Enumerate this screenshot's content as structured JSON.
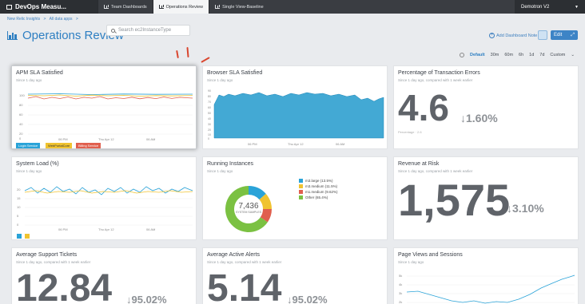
{
  "topbar": {
    "app_title": "DevOps Measu...",
    "tabs": [
      "Team Dashboards",
      "Operations Review",
      "Single View-Baseline"
    ],
    "account": "Demotron V2"
  },
  "breadcrumb": [
    "New Relic Insights",
    ">",
    "All data apps",
    ">"
  ],
  "page_title": "Operations Review",
  "search": {
    "placeholder": "Search ec2InstanceType"
  },
  "actions": {
    "note": "Add Dashboard Note",
    "edit": "Edit"
  },
  "time_range": {
    "options": [
      "Default",
      "30m",
      "60m",
      "6h",
      "1d",
      "7d",
      "Custom"
    ],
    "selected": "Default"
  },
  "widgets": {
    "apm": {
      "title": "APM SLA Satisfied",
      "subtitle": "Since 1 day ago",
      "y_ticks": [
        "100",
        "80",
        "60",
        "40",
        "20",
        "0"
      ],
      "x_ticks": [
        "06 PM",
        "Thu Apr 12",
        "06 AM"
      ],
      "legend": [
        "Login Service",
        "WebPortalCore",
        "Billing Service"
      ],
      "colors": [
        "#2aa3d8",
        "#f0c330",
        "#e05f4e"
      ]
    },
    "browser": {
      "title": "Browser SLA Satisfied",
      "subtitle": "Since 1 day ago",
      "y_ticks": [
        "90",
        "80",
        "70",
        "60",
        "50",
        "40",
        "30",
        "20",
        "10",
        "0"
      ],
      "x_ticks": [
        "06 PM",
        "Thu Apr 12",
        "06 AM"
      ],
      "color": "#43a9d4"
    },
    "errors": {
      "title": "Percentage of Transaction Errors",
      "subtitle": "Since 1 day ago, compared with 1 week earlier",
      "value": "4.6",
      "change": "1.60%",
      "footnote": "Percentage · 2.6"
    },
    "sysload": {
      "title": "System Load (%)",
      "subtitle": "Since 1 day ago",
      "y_ticks": [
        "20",
        "15",
        "10",
        "5",
        "0"
      ],
      "x_ticks": [
        "06 PM",
        "Thu Apr 12",
        "06 AM"
      ],
      "colors": [
        "#2aa3d8",
        "#f0c330"
      ]
    },
    "instances": {
      "title": "Running Instances",
      "subtitle": "Since 1 day ago",
      "center_value": "7,436",
      "center_label": "SYSTEM SAMPLES",
      "legend": [
        "m3.large (13.5%)",
        "m3.medium (11.5%)",
        "m1.medium (9.62%)",
        "Other (65.4%)"
      ],
      "chart_data": {
        "type": "pie",
        "categories": [
          "m3.large",
          "m3.medium",
          "m1.medium",
          "Other"
        ],
        "values": [
          13.5,
          11.5,
          9.62,
          65.4
        ],
        "colors": [
          "#2aa3d8",
          "#f0c330",
          "#e05f4e",
          "#7bc142"
        ]
      }
    },
    "revenue": {
      "title": "Revenue at Risk",
      "subtitle": "Since 1 day ago, compared with 1 week earlier",
      "value": "1,575",
      "change": "3.10%"
    },
    "tickets": {
      "title": "Average Support Tickets",
      "subtitle": "Since 1 day ago, compared with 1 week earlier",
      "value": "12.84",
      "change": "95.02%"
    },
    "alerts": {
      "title": "Average Active Alerts",
      "subtitle": "Since 1 day ago, compared with 1 week earlier",
      "value": "5.14",
      "change": "95.02%"
    },
    "pageviews": {
      "title": "Page Views and Sessions",
      "subtitle": "Since 1 day ago",
      "y_ticks": [
        "5k",
        "4k",
        "3k",
        "2k"
      ],
      "color": "#2aa3d8"
    }
  }
}
